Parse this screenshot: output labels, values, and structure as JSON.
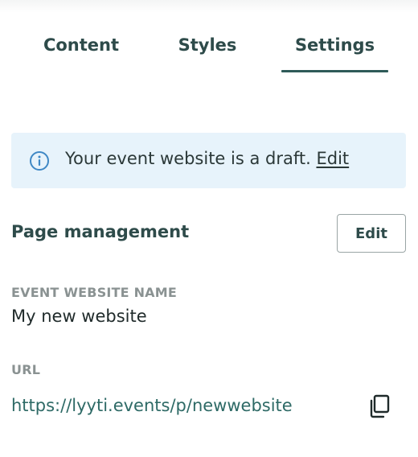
{
  "tabs": [
    {
      "label": "Content",
      "active": false
    },
    {
      "label": "Styles",
      "active": false
    },
    {
      "label": "Settings",
      "active": true
    }
  ],
  "banner": {
    "icon": "info-icon",
    "message": "Your event website is a draft.",
    "link_label": "Edit"
  },
  "page_management": {
    "title": "Page management",
    "edit_label": "Edit"
  },
  "fields": {
    "name_label": "EVENT WEBSITE NAME",
    "name_value": "My new website",
    "url_label": "URL",
    "url_value": "https://lyyti.events/p/newwebsite",
    "copy_icon": "copy-icon"
  },
  "colors": {
    "accent": "#2e5a58",
    "banner_bg": "#e7f3fb",
    "link": "#2e6a66",
    "info_icon": "#3f88c5"
  }
}
